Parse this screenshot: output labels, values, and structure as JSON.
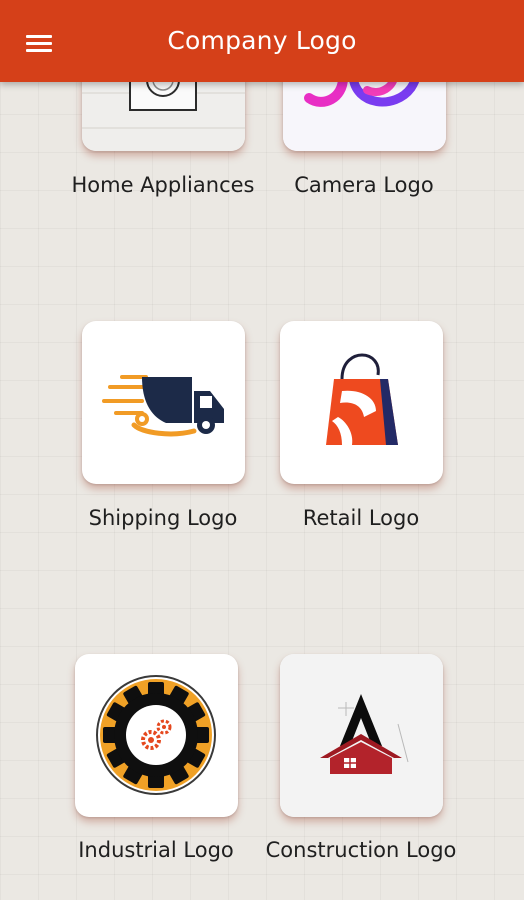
{
  "appbar": {
    "title": "Company Logo",
    "menu_icon": "hamburger-menu-icon",
    "color": "#d54019"
  },
  "grid": {
    "items": [
      {
        "label": "Home Appliances",
        "icon": "washing-machine-icon"
      },
      {
        "label": "Camera Logo",
        "icon": "camera-swirl-icon"
      },
      {
        "label": "Shipping Logo",
        "icon": "delivery-truck-icon"
      },
      {
        "label": "Retail Logo",
        "icon": "shopping-bag-icon"
      },
      {
        "label": "Industrial Logo",
        "icon": "gear-icon"
      },
      {
        "label": "Construction Logo",
        "icon": "house-roof-icon"
      }
    ]
  }
}
